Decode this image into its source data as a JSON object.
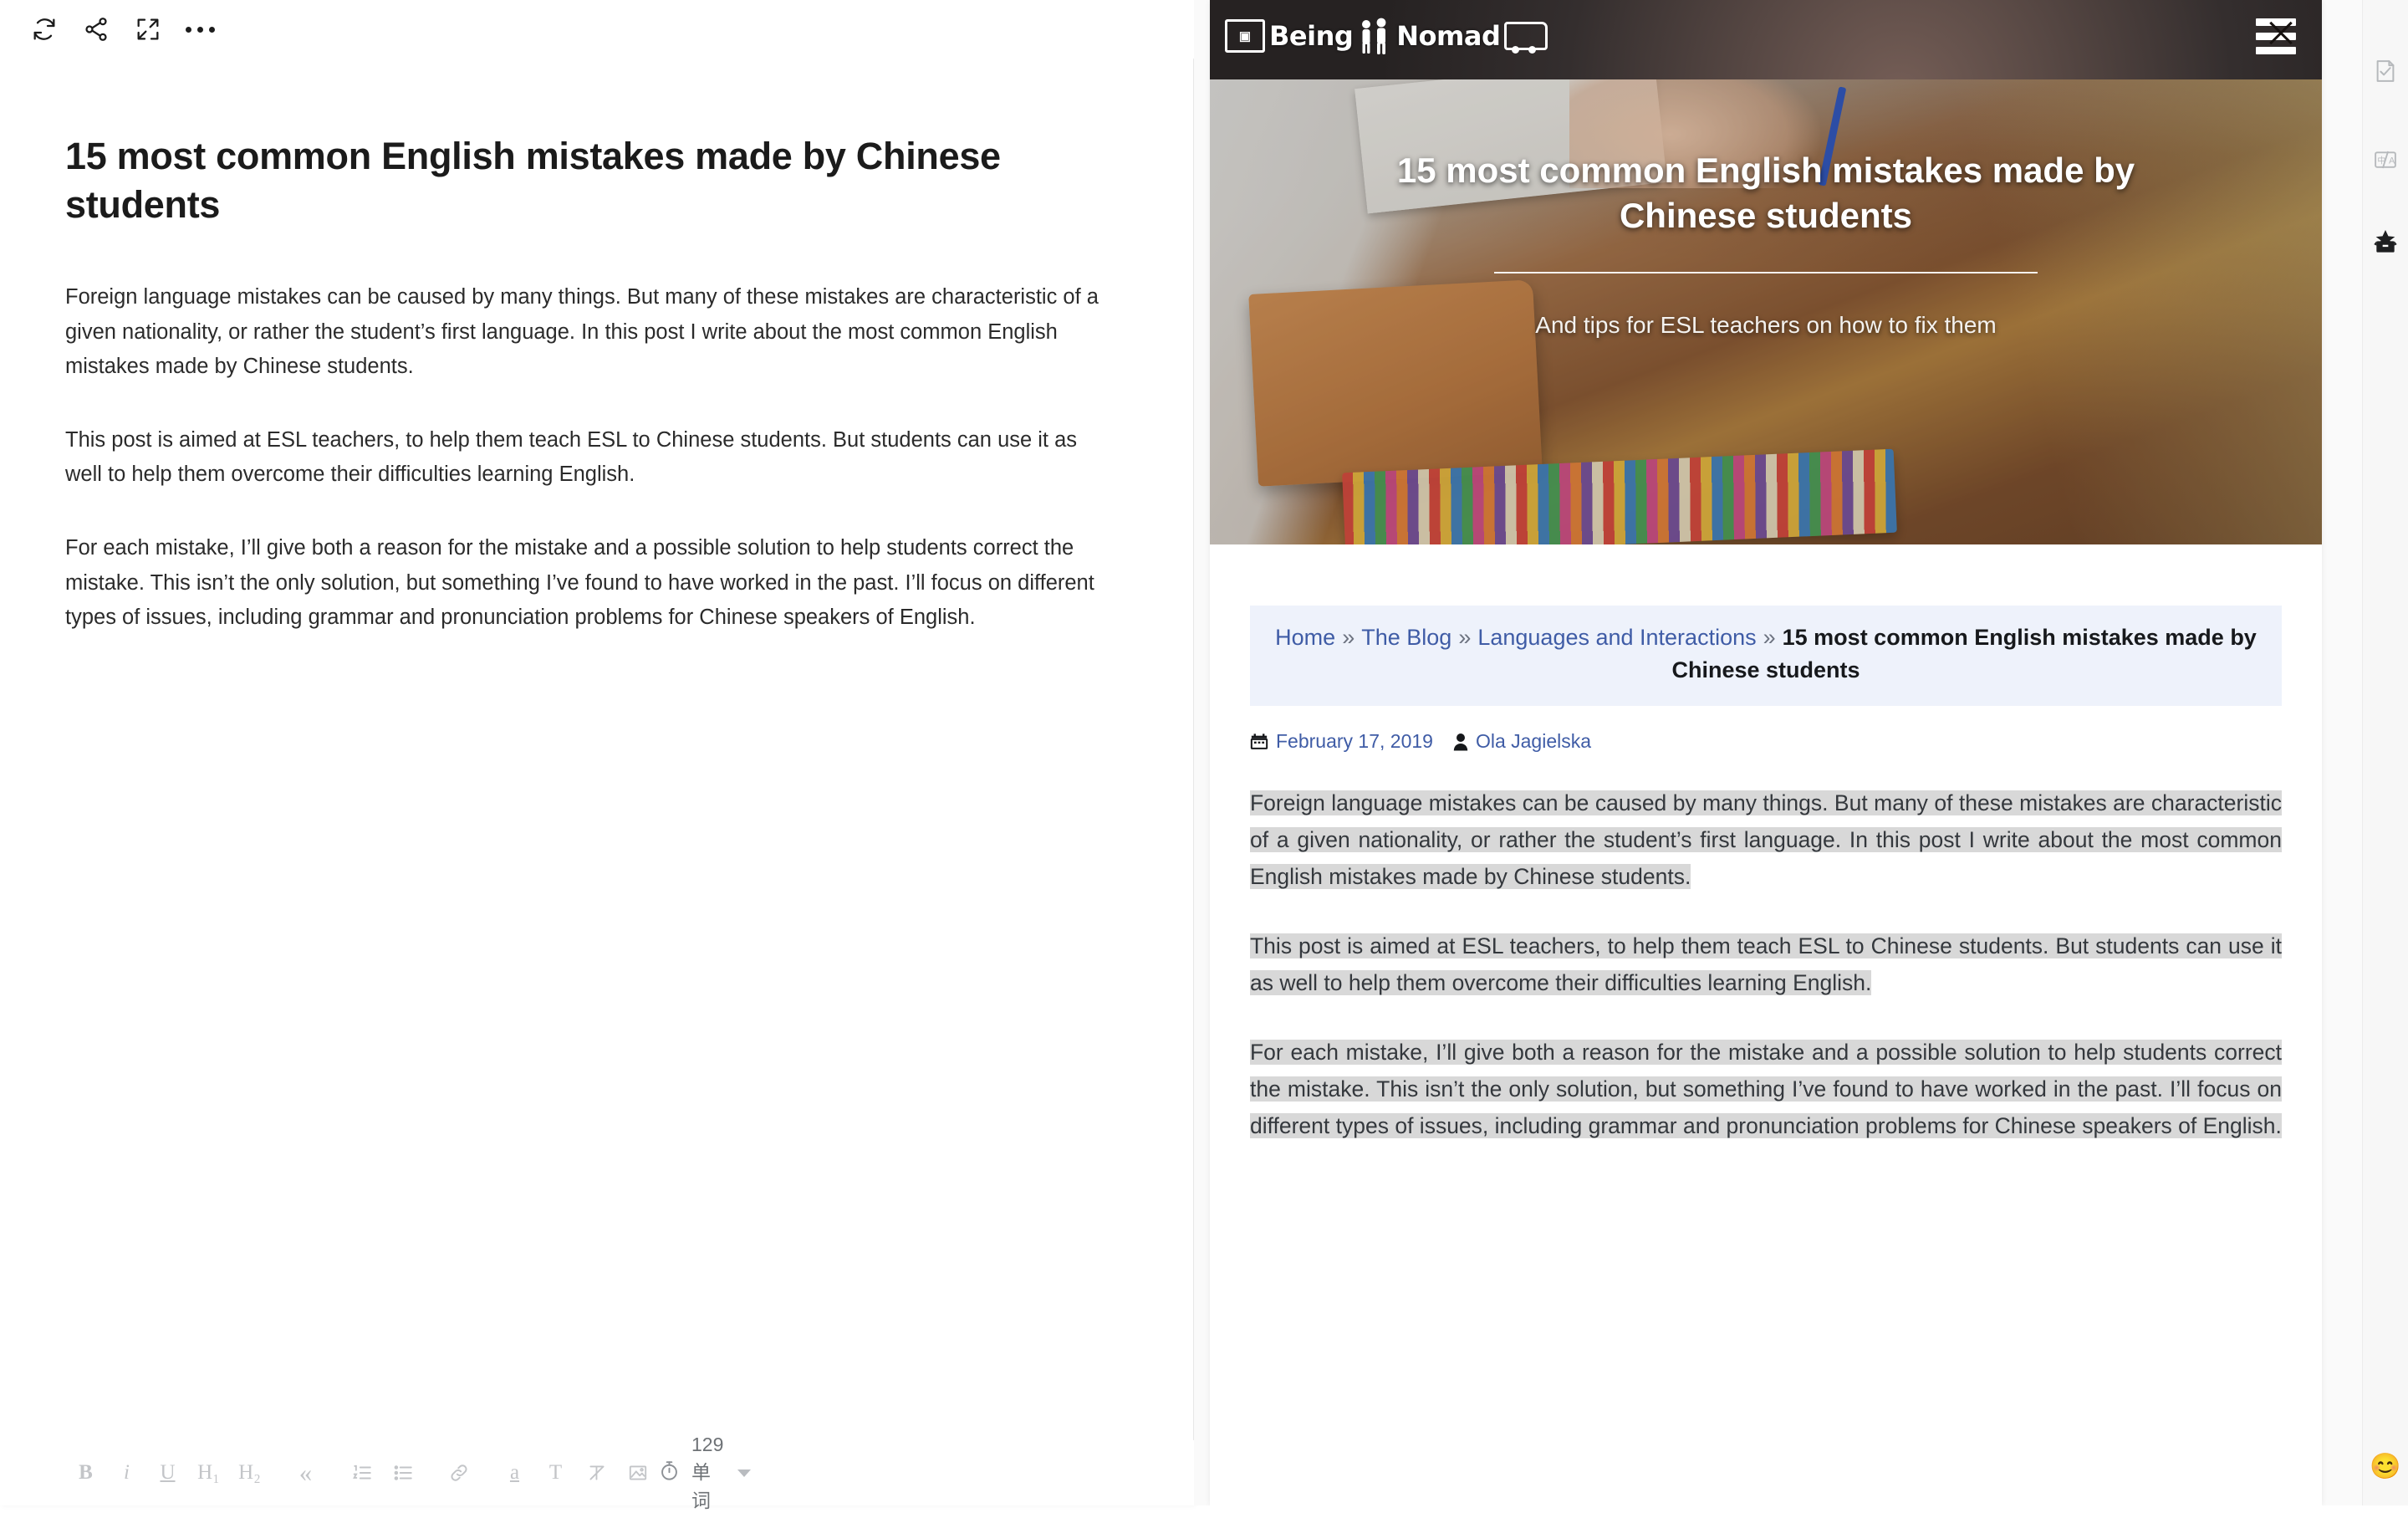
{
  "editor": {
    "toolbar_top": [
      {
        "name": "sync-icon",
        "label": "Sync"
      },
      {
        "name": "share-icon",
        "label": "Share"
      },
      {
        "name": "fullscreen-icon",
        "label": "Fullscreen"
      },
      {
        "name": "more-icon",
        "label": "More"
      }
    ],
    "title": "15 most common English mistakes made by Chinese students",
    "paragraphs": [
      "Foreign language mistakes can be caused by many things. But many of these mistakes are characteristic of a given nationality, or rather the student’s first language. In this post I write about the most common English mistakes made by Chinese students.",
      "This post is aimed at ESL teachers, to help them teach ESL to Chinese students. But students can use it as well to help them overcome their difficulties learning English.",
      "For each mistake, I’ll give both a reason for the mistake and a possible solution to help students correct the mistake. This isn’t the only solution, but something I’ve found to have worked in the past. I’ll focus on different types of issues, including grammar and pronunciation problems for Chinese speakers of English."
    ],
    "format_buttons": [
      {
        "name": "bold-button",
        "label": "B"
      },
      {
        "name": "italic-button",
        "label": "i"
      },
      {
        "name": "underline-button",
        "label": "U"
      },
      {
        "name": "heading-1-button",
        "label": "H₁"
      },
      {
        "name": "heading-2-button",
        "label": "H₂"
      },
      {
        "name": "blockquote-button",
        "label": "«"
      },
      {
        "name": "ordered-list-button",
        "label": "list-ol"
      },
      {
        "name": "unordered-list-button",
        "label": "list-ul"
      },
      {
        "name": "link-button",
        "label": "link"
      },
      {
        "name": "highlight-button",
        "label": "a"
      },
      {
        "name": "text-style-button",
        "label": "T"
      },
      {
        "name": "clear-format-button",
        "label": "clear"
      },
      {
        "name": "insert-image-button",
        "label": "image"
      }
    ],
    "word_count": "129 单词"
  },
  "preview": {
    "site_name": "Being A Nomad",
    "logo_parts": {
      "word1": "Being",
      "word2": "A",
      "word3": "Nomad"
    },
    "menu_label": "Menu",
    "hero": {
      "title": "15 most common English mistakes made by Chinese students",
      "subtitle": "And tips for ESL teachers on how to fix them"
    },
    "breadcrumb": {
      "items": [
        {
          "label": "Home",
          "link": true
        },
        {
          "label": "The Blog",
          "link": true
        },
        {
          "label": "Languages and Interactions",
          "link": true
        },
        {
          "label": "15 most common English mistakes made by Chinese students",
          "link": false
        }
      ],
      "separator": "»"
    },
    "meta": {
      "date": "February 17, 2019",
      "author": "Ola Jagielska",
      "date_icon": "calendar-icon",
      "author_icon": "user-icon"
    },
    "paragraphs": [
      "Foreign language mistakes can be caused by many things. But many of these mistakes are characteristic of a given nationality, or rather the student’s first language. In this post I write about the most common English mistakes made by Chinese students.",
      "This post is aimed at ESL teachers, to help them teach ESL to Chinese students. But students can use it as well to help them overcome their difficulties learning English.",
      "For each mistake, I’ll give both a reason for the mistake and a possible solution to help students correct the mistake. This isn’t the only solution, but something I’ve found to have worked in the past. I’ll focus on different types of issues, including grammar and pronunciation problems for Chinese speakers of English."
    ]
  },
  "rail": {
    "items": [
      {
        "name": "proofread-icon",
        "label": "Proofread"
      },
      {
        "name": "translate-icon",
        "label": "Translate"
      },
      {
        "name": "publish-icon",
        "label": "Publish"
      }
    ],
    "emoji": "😊"
  },
  "colors": {
    "accent_link": "#3f5ca6",
    "breadcrumb_bg": "#eef2fb",
    "selection_bg": "#d8d8d8",
    "header_bg": "#2f2c2e"
  }
}
